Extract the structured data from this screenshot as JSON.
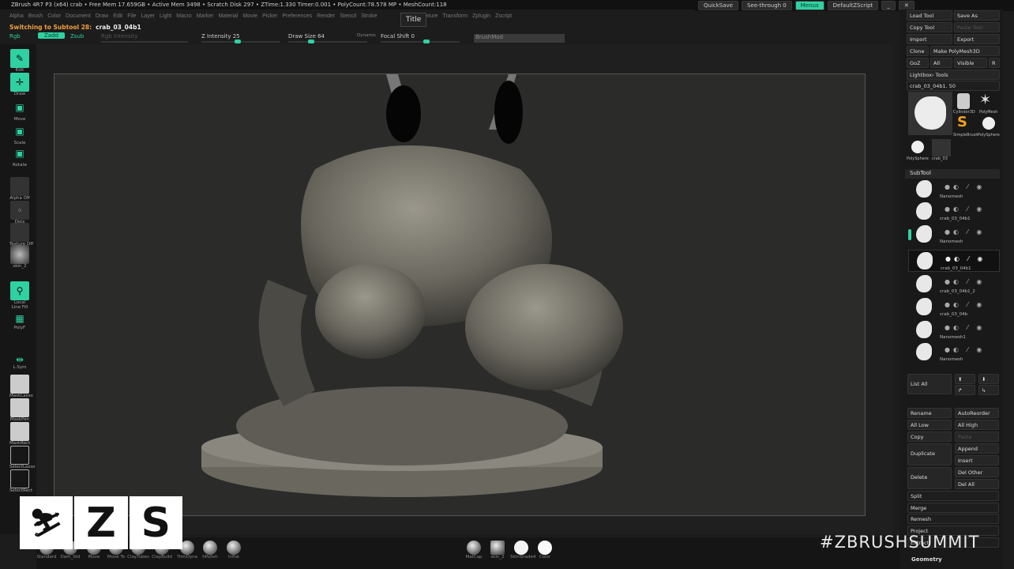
{
  "titlebar": {
    "text": "ZBrush 4R7 P3 (x64)   crab    • Free Mem 17.659GB • Active Mem 3498 • Scratch Disk 297 •  ZTime:1.330 Timer:0.001 • PolyCount:78.578 MP  • MeshCount:118"
  },
  "topright": {
    "quicksave": "QuickSave",
    "seethrough": "See-through  0",
    "menus": "Menus",
    "script": "DefaultZScript"
  },
  "menubar": [
    "Alpha",
    "Brush",
    "Color",
    "Document",
    "Draw",
    "Edit",
    "File",
    "Layer",
    "Light",
    "Macro",
    "Marker",
    "Material",
    "Movie",
    "Picker",
    "Preferences",
    "Render",
    "Stencil",
    "Stroke",
    "Texture",
    "Transform",
    "Zplugin",
    "Zscript"
  ],
  "tooltip": "Title",
  "status": {
    "label": "Switching to Subtool 28:",
    "name": "crab_03_04b1"
  },
  "drawbar": {
    "rgb": "Rgb",
    "zadd": "Zadd",
    "zsub": "Zsub",
    "rgb_intensity": "Rgb Intensity",
    "z_intensity": "Z Intensity 25",
    "draw_size": "Draw Size 64",
    "dynamic": "Dynamic",
    "focal_shift": "Focal Shift 0",
    "brushmod": "BrushMod"
  },
  "lefttools": [
    "Edit",
    "Draw",
    "Move",
    "Scale",
    "Rotate",
    "Alpha Off",
    "Dots",
    "Texture Off",
    "skin_2",
    "Local",
    "Line Fill",
    "PolyF",
    "L.Sym",
    "MaskLasso",
    "MaskPen",
    "MaskRect",
    "SelectLasso",
    "SelectRect"
  ],
  "tool": {
    "load": "Load Tool",
    "saveas": "Save As",
    "copy": "Copy Tool",
    "paste": "Paste Tool",
    "import": "Import",
    "export": "Export",
    "clone": "Clone",
    "makepoly": "Make PolyMesh3D",
    "goz": "GoZ",
    "all": "All",
    "visible": "Visible",
    "r": "R",
    "lightbox": "Lightbox› Tools",
    "current": "crab_03_04b1. 50",
    "thumbs": [
      "Cylinder3D",
      "PolyMesh",
      "SimpleBrush",
      "PolySphere",
      "PolySphere",
      "crab_03"
    ]
  },
  "subtool": {
    "title": "SubTool",
    "items": [
      "Nanomesh",
      "crab_03_04b1",
      "Nanomesh",
      "crab_03_04b1",
      "crab_03_04b1_2",
      "crab_03_04b",
      "Nanomesh1",
      "Nanomesh"
    ]
  },
  "subtool_actions": {
    "listall": "List All",
    "rename": "Rename",
    "autoreorder": "AutoReorder",
    "alllow": "All Low",
    "allhigh": "All High",
    "copy": "Copy",
    "paste": "Paste",
    "duplicate": "Duplicate",
    "append": "Append",
    "insert": "Insert",
    "delete": "Delete",
    "delother": "Del Other",
    "delall": "Del All",
    "split": "Split",
    "merge": "Merge",
    "remesh": "Remesh",
    "project": "Project",
    "extract": "Extract",
    "geometry": "Geometry"
  },
  "brushes": [
    "Standard",
    "Dam_Std",
    "Move",
    "Move To",
    "ClayTubes",
    "ClayBuild",
    "TrimDyna",
    "hPolish",
    "Inflat"
  ],
  "materials": [
    "MatCap",
    "skin_2",
    "SkinShade4",
    "Color"
  ],
  "watermark": "#ZBRUSHSUMMIT",
  "logo": "ZS"
}
